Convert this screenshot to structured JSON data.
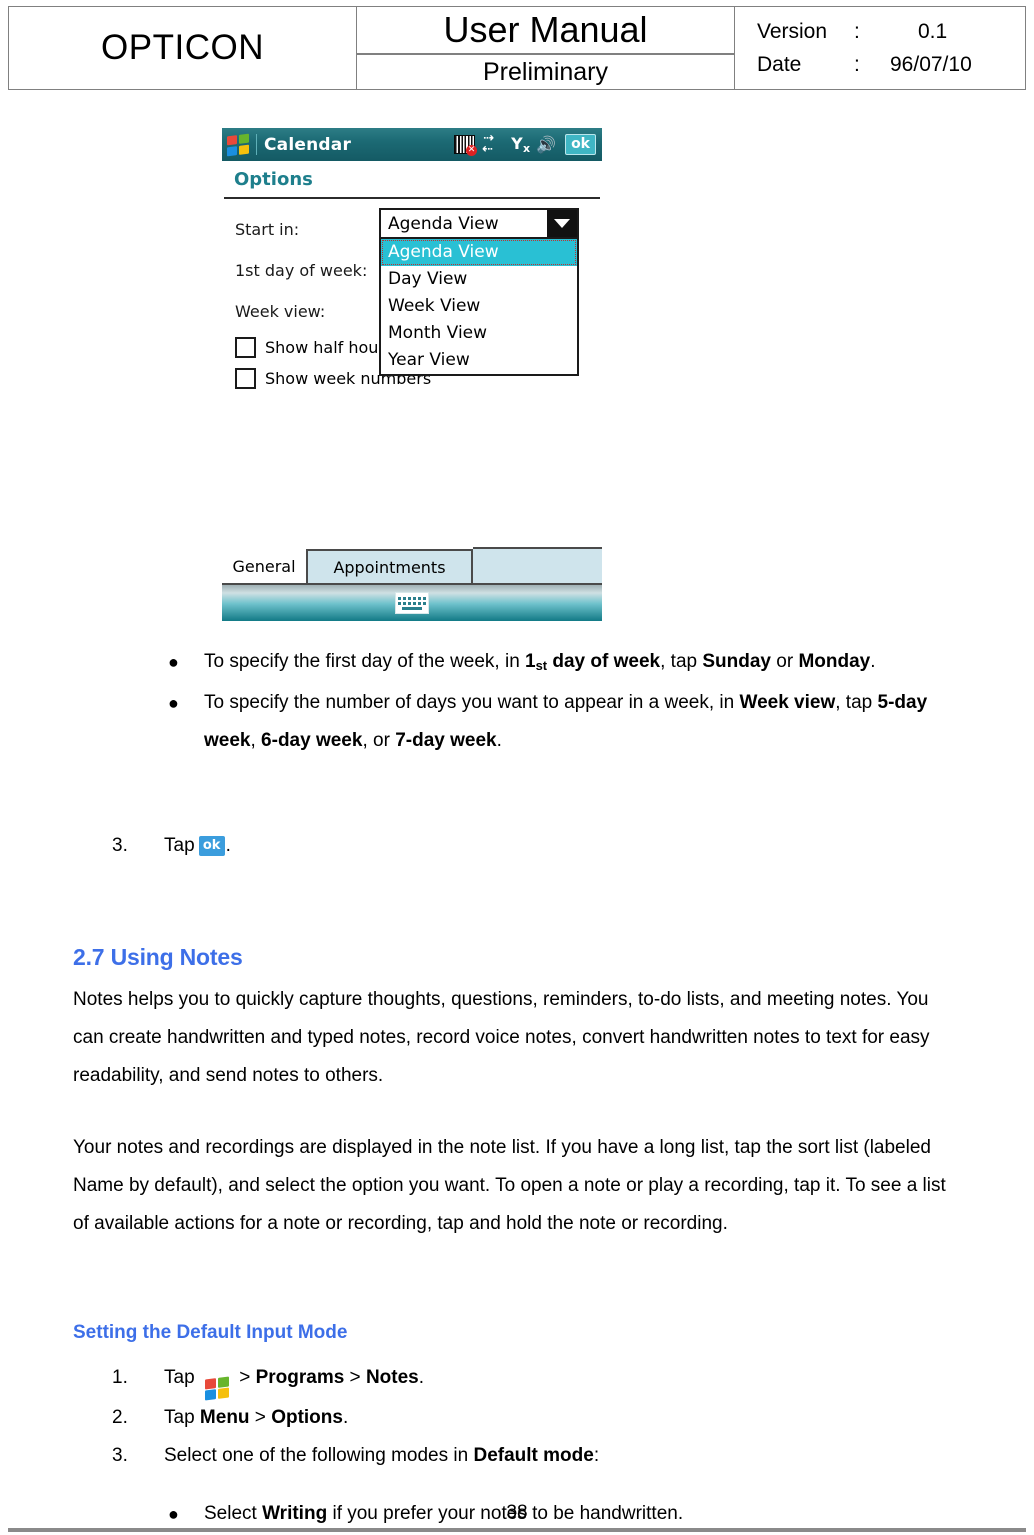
{
  "header": {
    "brand": "OPTICON",
    "title": "User Manual",
    "subtitle": "Preliminary",
    "version_label": "Version",
    "version_colon": ":",
    "version_value": "0.1",
    "date_label": "Date",
    "date_colon": ":",
    "date_value": "96/07/10"
  },
  "pda": {
    "app_title": "Calendar",
    "ok_button": "ok",
    "page_title": "Options",
    "icons": {
      "start_flag": "windows-flag-icon",
      "barcode": "barcode-disabled-icon",
      "connectivity": "connectivity-icon",
      "signal": "signal-off-icon",
      "speaker": "speaker-icon",
      "keyboard": "soft-keyboard-icon"
    },
    "fields": {
      "start_in_label": "Start in:",
      "first_day_label": "1st day of week:",
      "week_view_label": "Week view:"
    },
    "dropdown": {
      "selected": "Agenda View",
      "options": [
        "Agenda View",
        "Day View",
        "Week View",
        "Month View",
        "Year View"
      ],
      "highlighted_index": 0
    },
    "checkboxes": [
      {
        "label": "Show half hour slots",
        "checked": false
      },
      {
        "label": "Show week numbers",
        "checked": false
      }
    ],
    "tabs": [
      {
        "label": "General",
        "active": true
      },
      {
        "label": "Appointments",
        "active": false
      }
    ]
  },
  "body": {
    "bullets_top": [
      "To specify the first day of the week, in <b>1<sub>st</sub> day of week</b>, tap <b>Sunday</b> or <b>Monday</b>.",
      "To specify the number of days you want to appear in a week, in <b>Week view</b>, tap <b>5-day week</b>, <b>6-day week</b>, or <b>7-day week</b>."
    ],
    "step3_num": "3.",
    "step3_text_before": "Tap",
    "step3_ok": "ok",
    "step3_text_after": ".",
    "section_heading": "2.7 Using Notes",
    "paragraph_1": "Notes helps you to quickly capture thoughts, questions, reminders, to-do lists, and meeting notes. You can create handwritten and typed notes, record voice notes, convert handwritten notes to text for easy readability, and send notes to others.",
    "paragraph_2": "Your notes and recordings are displayed in the note list. If you have a long list, tap the sort list (labeled Name by default), and select the option you want. To open a note or play a recording, tap it. To see a list of available actions for a note or recording, tap and hold the note or recording.",
    "subsection_heading": "Setting the Default Input Mode",
    "steps": [
      {
        "num": "1.",
        "html": "Tap <span class=\"wf-slot\"></span> &gt; <b>Programs</b> &gt; <b>Notes</b>."
      },
      {
        "num": "2.",
        "html": "Tap <b>Menu</b> &gt; <b>Options</b>."
      },
      {
        "num": "3.",
        "html": "Select one of the following modes in <b>Default mode</b>:"
      }
    ],
    "sub_bullet": "Select <b>Writing</b> if you prefer your notes to be handwritten."
  },
  "footer": {
    "page_number": "38"
  },
  "colors": {
    "heading_blue": "#3d6fe8",
    "pda_title_teal": "#1e7f8c",
    "dropdown_highlight": "#29c0d4",
    "ok_button_blue": "#3b9ddd",
    "rule_gray": "#808080"
  }
}
